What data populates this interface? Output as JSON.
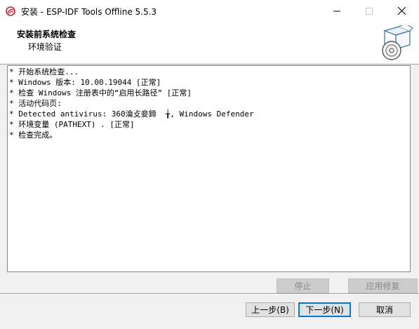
{
  "window": {
    "title": "安装 - ESP-IDF Tools Offline 5.5.3"
  },
  "header": {
    "title": "安装前系统检查",
    "subtitle": "环境验证"
  },
  "log": {
    "lines": [
      "* 开始系统检查...",
      "* Windows 版本: 10.00.19044 [正常]",
      "* 检查 Windows 注册表中的“启用长路径” [正常]",
      "* 活动代码页:",
      "* Detected antivirus: 360淪攴妾鍗  ╁, Windows Defender",
      "* 环境变量 (PATHEXT) . [正常]",
      "* 检查完成。"
    ]
  },
  "buttons": {
    "stop": "停止",
    "fix": "应用修复",
    "back": "上一步(B)",
    "next": "下一步(N)",
    "cancel": "取消"
  },
  "colors": {
    "accent": "#0078d7",
    "icon_red": "#d0202a"
  }
}
